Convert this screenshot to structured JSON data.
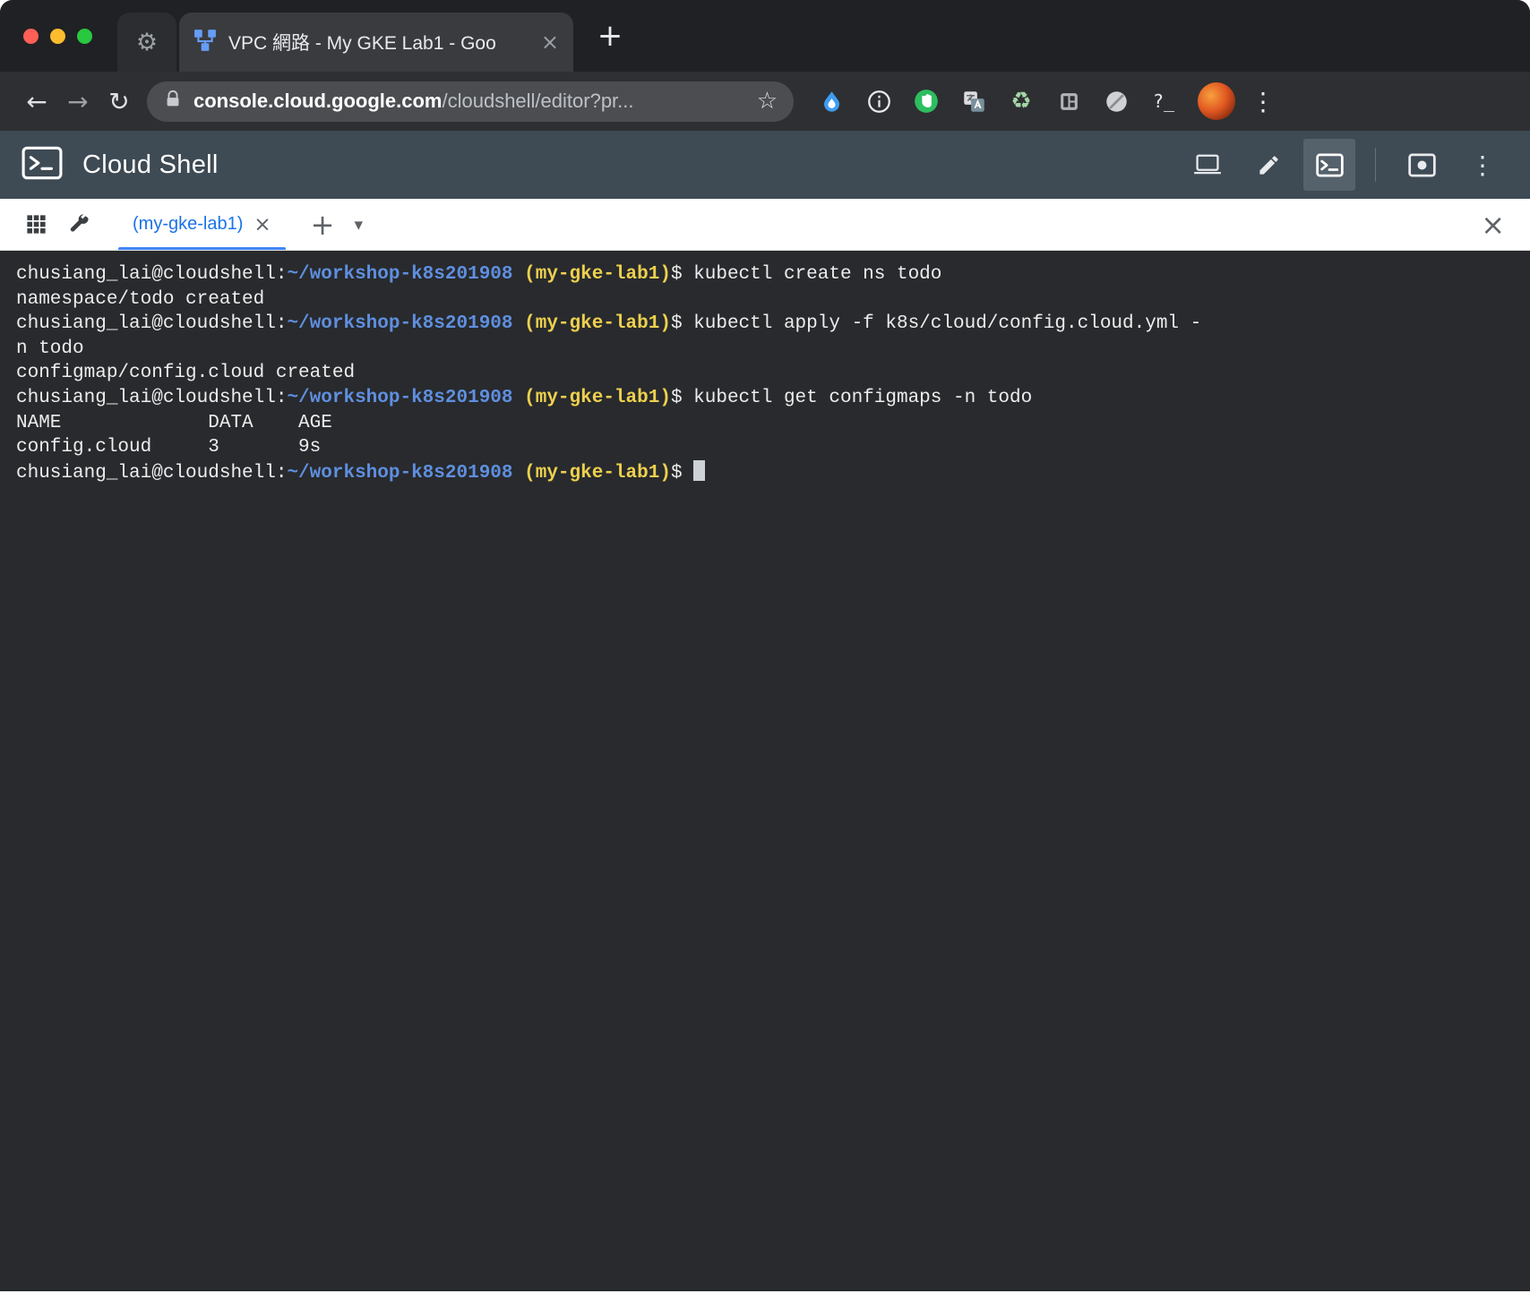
{
  "browser": {
    "active_tab_title": "VPC 網路 - My GKE Lab1 - Goo",
    "url_domain": "console.cloud.google.com",
    "url_path": "/cloudshell/editor?pr...",
    "question_extension_label": "?_"
  },
  "cloud_shell": {
    "title": "Cloud Shell"
  },
  "terminal_tabbar": {
    "tab_label": "(my-gke-lab1)"
  },
  "glyphs": {
    "back": "←",
    "forward": "→",
    "reload": "↻",
    "bookmark_star": "☆",
    "gear": "⚙",
    "recycle": "♻",
    "tab_close": "×",
    "new_tab_plus": "+",
    "add_session_plus": "+",
    "dropdown_caret": "▾",
    "kebab_menu": "⋮",
    "panel_close": "×",
    "session_tab_close": "×"
  },
  "colors": {
    "fg": "#ededed",
    "path": "#5f8fe0",
    "proj": "#eed04e",
    "cursor": "#ccd2d6",
    "terminal_bg": "#282a2d",
    "header_bg": "#3e4a54",
    "tab_accent": "#1a73e8"
  },
  "terminal": {
    "lines": [
      [
        {
          "t": "chusiang_lai@cloudshell:",
          "c": "fg"
        },
        {
          "t": "~/workshop-k8s201908",
          "c": "path"
        },
        {
          "t": " ",
          "c": "fg"
        },
        {
          "t": "(my-gke-lab1)",
          "c": "proj"
        },
        {
          "t": "$ kubectl create ns todo",
          "c": "fg"
        }
      ],
      [
        {
          "t": "namespace/todo created",
          "c": "fg"
        }
      ],
      [
        {
          "t": "chusiang_lai@cloudshell:",
          "c": "fg"
        },
        {
          "t": "~/workshop-k8s201908",
          "c": "path"
        },
        {
          "t": " ",
          "c": "fg"
        },
        {
          "t": "(my-gke-lab1)",
          "c": "proj"
        },
        {
          "t": "$ kubectl apply -f k8s/cloud/config.cloud.yml -",
          "c": "fg"
        }
      ],
      [
        {
          "t": "n todo",
          "c": "fg"
        }
      ],
      [
        {
          "t": "configmap/config.cloud created",
          "c": "fg"
        }
      ],
      [
        {
          "t": "chusiang_lai@cloudshell:",
          "c": "fg"
        },
        {
          "t": "~/workshop-k8s201908",
          "c": "path"
        },
        {
          "t": " ",
          "c": "fg"
        },
        {
          "t": "(my-gke-lab1)",
          "c": "proj"
        },
        {
          "t": "$ kubectl get configmaps -n todo",
          "c": "fg"
        }
      ],
      [
        {
          "t": "NAME             DATA    AGE",
          "c": "fg"
        }
      ],
      [
        {
          "t": "config.cloud     3       9s",
          "c": "fg"
        }
      ],
      [
        {
          "t": "chusiang_lai@cloudshell:",
          "c": "fg"
        },
        {
          "t": "~/workshop-k8s201908",
          "c": "path"
        },
        {
          "t": " ",
          "c": "fg"
        },
        {
          "t": "(my-gke-lab1)",
          "c": "proj"
        },
        {
          "t": "$ ",
          "c": "fg"
        },
        {
          "t": " ",
          "c": "cursor"
        }
      ]
    ]
  }
}
